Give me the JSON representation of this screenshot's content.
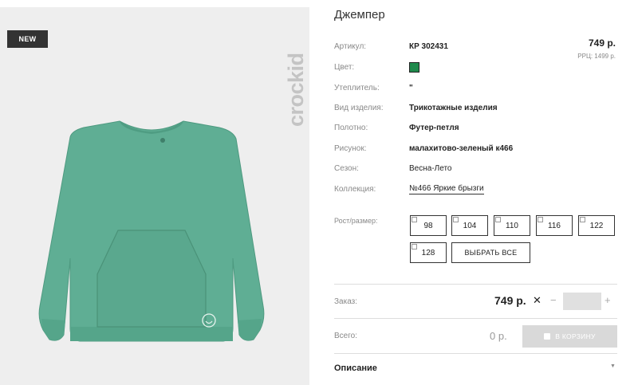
{
  "product": {
    "badge": "NEW",
    "brand": "crockid",
    "title": "Джемпер",
    "price": "749 р.",
    "rrp": "РРЦ: 1499 р."
  },
  "attributes": [
    {
      "label": "Артикул:",
      "value": "КР 302431"
    },
    {
      "label": "Цвет:",
      "value": ""
    },
    {
      "label": "Утеплитель:",
      "value": "\""
    },
    {
      "label": "Вид изделия:",
      "value": "Трикотажные изделия"
    },
    {
      "label": "Полотно:",
      "value": "Футер-петля"
    },
    {
      "label": "Рисунок:",
      "value": "малахитово-зеленый к466"
    },
    {
      "label": "Сезон:",
      "value": "Весна-Лето"
    },
    {
      "label": "Коллекция:",
      "value": "№466 Яркие брызги"
    }
  ],
  "colors": {
    "swatch": "#1f8a4c",
    "sweater": "#5fae94"
  },
  "sizes": {
    "label": "Рост/размер:",
    "options": [
      "98",
      "104",
      "110",
      "116",
      "122",
      "128"
    ],
    "select_all": "ВЫБРАТЬ ВСЕ"
  },
  "order": {
    "label": "Заказ:",
    "price": "749 р.",
    "times": "✕",
    "minus": "−",
    "plus": "+",
    "quantity": ""
  },
  "total": {
    "label": "Всего:",
    "value": "0 р.",
    "cart_button": "В КОРЗИНУ"
  },
  "description": {
    "label": "Описание",
    "chevron": "▼"
  }
}
